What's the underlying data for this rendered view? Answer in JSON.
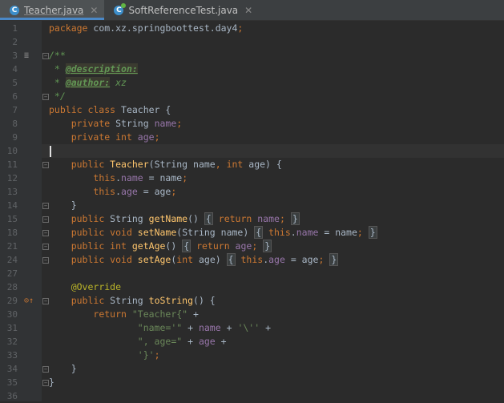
{
  "tabs": [
    {
      "label": "Teacher.java",
      "icon": "C",
      "active": true,
      "close": "✕"
    },
    {
      "label": "SoftReferenceTest.java",
      "icon": "C",
      "active": false,
      "close": "✕"
    }
  ],
  "colors": {
    "background": "#2b2b2b",
    "keyword": "#cc7832",
    "field": "#9876aa",
    "string": "#6a8759",
    "method": "#ffc66d",
    "annotation": "#bbb529",
    "doc": "#629755",
    "tab_accent": "#4a88c7"
  },
  "editor": {
    "current_line": "10",
    "lines": [
      {
        "n": "1",
        "fold": false,
        "mark": "",
        "tokens": [
          [
            "kw",
            "package "
          ],
          [
            "p",
            "com.xz.springboottest.day4"
          ],
          [
            "kw",
            ";"
          ]
        ]
      },
      {
        "n": "2",
        "fold": false,
        "mark": "",
        "tokens": []
      },
      {
        "n": "3",
        "fold": true,
        "mark": "doc-list",
        "tokens": [
          [
            "doc",
            "/**"
          ]
        ]
      },
      {
        "n": "4",
        "fold": false,
        "mark": "",
        "tokens": [
          [
            "doc",
            " * "
          ],
          [
            "tag",
            "@description:"
          ]
        ]
      },
      {
        "n": "5",
        "fold": false,
        "mark": "",
        "tokens": [
          [
            "doc",
            " * "
          ],
          [
            "tag",
            "@author:"
          ],
          [
            "doc",
            " xz"
          ]
        ]
      },
      {
        "n": "6",
        "fold": true,
        "mark": "",
        "tokens": [
          [
            "doc",
            " */"
          ]
        ]
      },
      {
        "n": "7",
        "fold": false,
        "mark": "",
        "tokens": [
          [
            "kw",
            "public class "
          ],
          [
            "p",
            "Teacher {"
          ]
        ]
      },
      {
        "n": "8",
        "fold": false,
        "mark": "",
        "tokens": [
          [
            "p",
            "    "
          ],
          [
            "kw",
            "private "
          ],
          [
            "p",
            "String "
          ],
          [
            "field",
            "name"
          ],
          [
            "kw",
            ";"
          ]
        ]
      },
      {
        "n": "9",
        "fold": false,
        "mark": "",
        "tokens": [
          [
            "p",
            "    "
          ],
          [
            "kw",
            "private int "
          ],
          [
            "field",
            "age"
          ],
          [
            "kw",
            ";"
          ]
        ]
      },
      {
        "n": "10",
        "fold": false,
        "mark": "",
        "tokens": []
      },
      {
        "n": "11",
        "fold": true,
        "mark": "",
        "tokens": [
          [
            "p",
            "    "
          ],
          [
            "kw",
            "public "
          ],
          [
            "fn",
            "Teacher"
          ],
          [
            "p",
            "(String name"
          ],
          [
            "kw",
            ", int "
          ],
          [
            "p",
            "age) {"
          ]
        ]
      },
      {
        "n": "12",
        "fold": false,
        "mark": "",
        "tokens": [
          [
            "p",
            "        "
          ],
          [
            "kw",
            "this"
          ],
          [
            "p",
            "."
          ],
          [
            "field",
            "name"
          ],
          [
            "p",
            " = name"
          ],
          [
            "kw",
            ";"
          ]
        ]
      },
      {
        "n": "13",
        "fold": false,
        "mark": "",
        "tokens": [
          [
            "p",
            "        "
          ],
          [
            "kw",
            "this"
          ],
          [
            "p",
            "."
          ],
          [
            "field",
            "age"
          ],
          [
            "p",
            " = age"
          ],
          [
            "kw",
            ";"
          ]
        ]
      },
      {
        "n": "14",
        "fold": true,
        "mark": "",
        "tokens": [
          [
            "p",
            "    }"
          ]
        ]
      },
      {
        "n": "15",
        "fold": true,
        "mark": "",
        "tokens": [
          [
            "p",
            "    "
          ],
          [
            "kw",
            "public "
          ],
          [
            "p",
            "String "
          ],
          [
            "fn",
            "getName"
          ],
          [
            "p",
            "() "
          ],
          [
            "fold",
            "{"
          ],
          [
            "p",
            " "
          ],
          [
            "kw",
            "return "
          ],
          [
            "field",
            "name"
          ],
          [
            "kw",
            ";"
          ],
          [
            "p",
            " "
          ],
          [
            "fold",
            "}"
          ]
        ]
      },
      {
        "n": "18",
        "fold": true,
        "mark": "",
        "tokens": [
          [
            "p",
            "    "
          ],
          [
            "kw",
            "public void "
          ],
          [
            "fn",
            "setName"
          ],
          [
            "p",
            "(String name) "
          ],
          [
            "fold",
            "{"
          ],
          [
            "p",
            " "
          ],
          [
            "kw",
            "this"
          ],
          [
            "p",
            "."
          ],
          [
            "field",
            "name"
          ],
          [
            "p",
            " = name"
          ],
          [
            "kw",
            ";"
          ],
          [
            "p",
            " "
          ],
          [
            "fold",
            "}"
          ]
        ]
      },
      {
        "n": "21",
        "fold": true,
        "mark": "",
        "tokens": [
          [
            "p",
            "    "
          ],
          [
            "kw",
            "public int "
          ],
          [
            "fn",
            "getAge"
          ],
          [
            "p",
            "() "
          ],
          [
            "fold",
            "{"
          ],
          [
            "p",
            " "
          ],
          [
            "kw",
            "return "
          ],
          [
            "field",
            "age"
          ],
          [
            "kw",
            ";"
          ],
          [
            "p",
            " "
          ],
          [
            "fold",
            "}"
          ]
        ]
      },
      {
        "n": "24",
        "fold": true,
        "mark": "",
        "tokens": [
          [
            "p",
            "    "
          ],
          [
            "kw",
            "public void "
          ],
          [
            "fn",
            "setAge"
          ],
          [
            "p",
            "("
          ],
          [
            "kw",
            "int "
          ],
          [
            "p",
            "age) "
          ],
          [
            "fold",
            "{"
          ],
          [
            "p",
            " "
          ],
          [
            "kw",
            "this"
          ],
          [
            "p",
            "."
          ],
          [
            "field",
            "age"
          ],
          [
            "p",
            " = age"
          ],
          [
            "kw",
            ";"
          ],
          [
            "p",
            " "
          ],
          [
            "fold",
            "}"
          ]
        ]
      },
      {
        "n": "27",
        "fold": false,
        "mark": "",
        "tokens": []
      },
      {
        "n": "28",
        "fold": false,
        "mark": "",
        "tokens": [
          [
            "p",
            "    "
          ],
          [
            "ann",
            "@Override"
          ]
        ]
      },
      {
        "n": "29",
        "fold": true,
        "mark": "override",
        "tokens": [
          [
            "p",
            "    "
          ],
          [
            "kw",
            "public "
          ],
          [
            "p",
            "String "
          ],
          [
            "fn",
            "toString"
          ],
          [
            "p",
            "() {"
          ]
        ]
      },
      {
        "n": "30",
        "fold": false,
        "mark": "",
        "tokens": [
          [
            "p",
            "        "
          ],
          [
            "kw",
            "return "
          ],
          [
            "str",
            "\"Teacher{\""
          ],
          [
            "p",
            " +"
          ]
        ]
      },
      {
        "n": "31",
        "fold": false,
        "mark": "",
        "tokens": [
          [
            "p",
            "                "
          ],
          [
            "str",
            "\"name='\""
          ],
          [
            "p",
            " + "
          ],
          [
            "field",
            "name"
          ],
          [
            "p",
            " + "
          ],
          [
            "str",
            "'\\''"
          ],
          [
            "p",
            " +"
          ]
        ]
      },
      {
        "n": "32",
        "fold": false,
        "mark": "",
        "tokens": [
          [
            "p",
            "                "
          ],
          [
            "str",
            "\", age=\""
          ],
          [
            "p",
            " + "
          ],
          [
            "field",
            "age"
          ],
          [
            "p",
            " +"
          ]
        ]
      },
      {
        "n": "33",
        "fold": false,
        "mark": "",
        "tokens": [
          [
            "p",
            "                "
          ],
          [
            "str",
            "'}'"
          ],
          [
            "kw",
            ";"
          ]
        ]
      },
      {
        "n": "34",
        "fold": true,
        "mark": "",
        "tokens": [
          [
            "p",
            "    }"
          ]
        ]
      },
      {
        "n": "35",
        "fold": true,
        "mark": "",
        "tokens": [
          [
            "p",
            "}"
          ]
        ]
      },
      {
        "n": "36",
        "fold": false,
        "mark": "",
        "tokens": []
      }
    ]
  }
}
